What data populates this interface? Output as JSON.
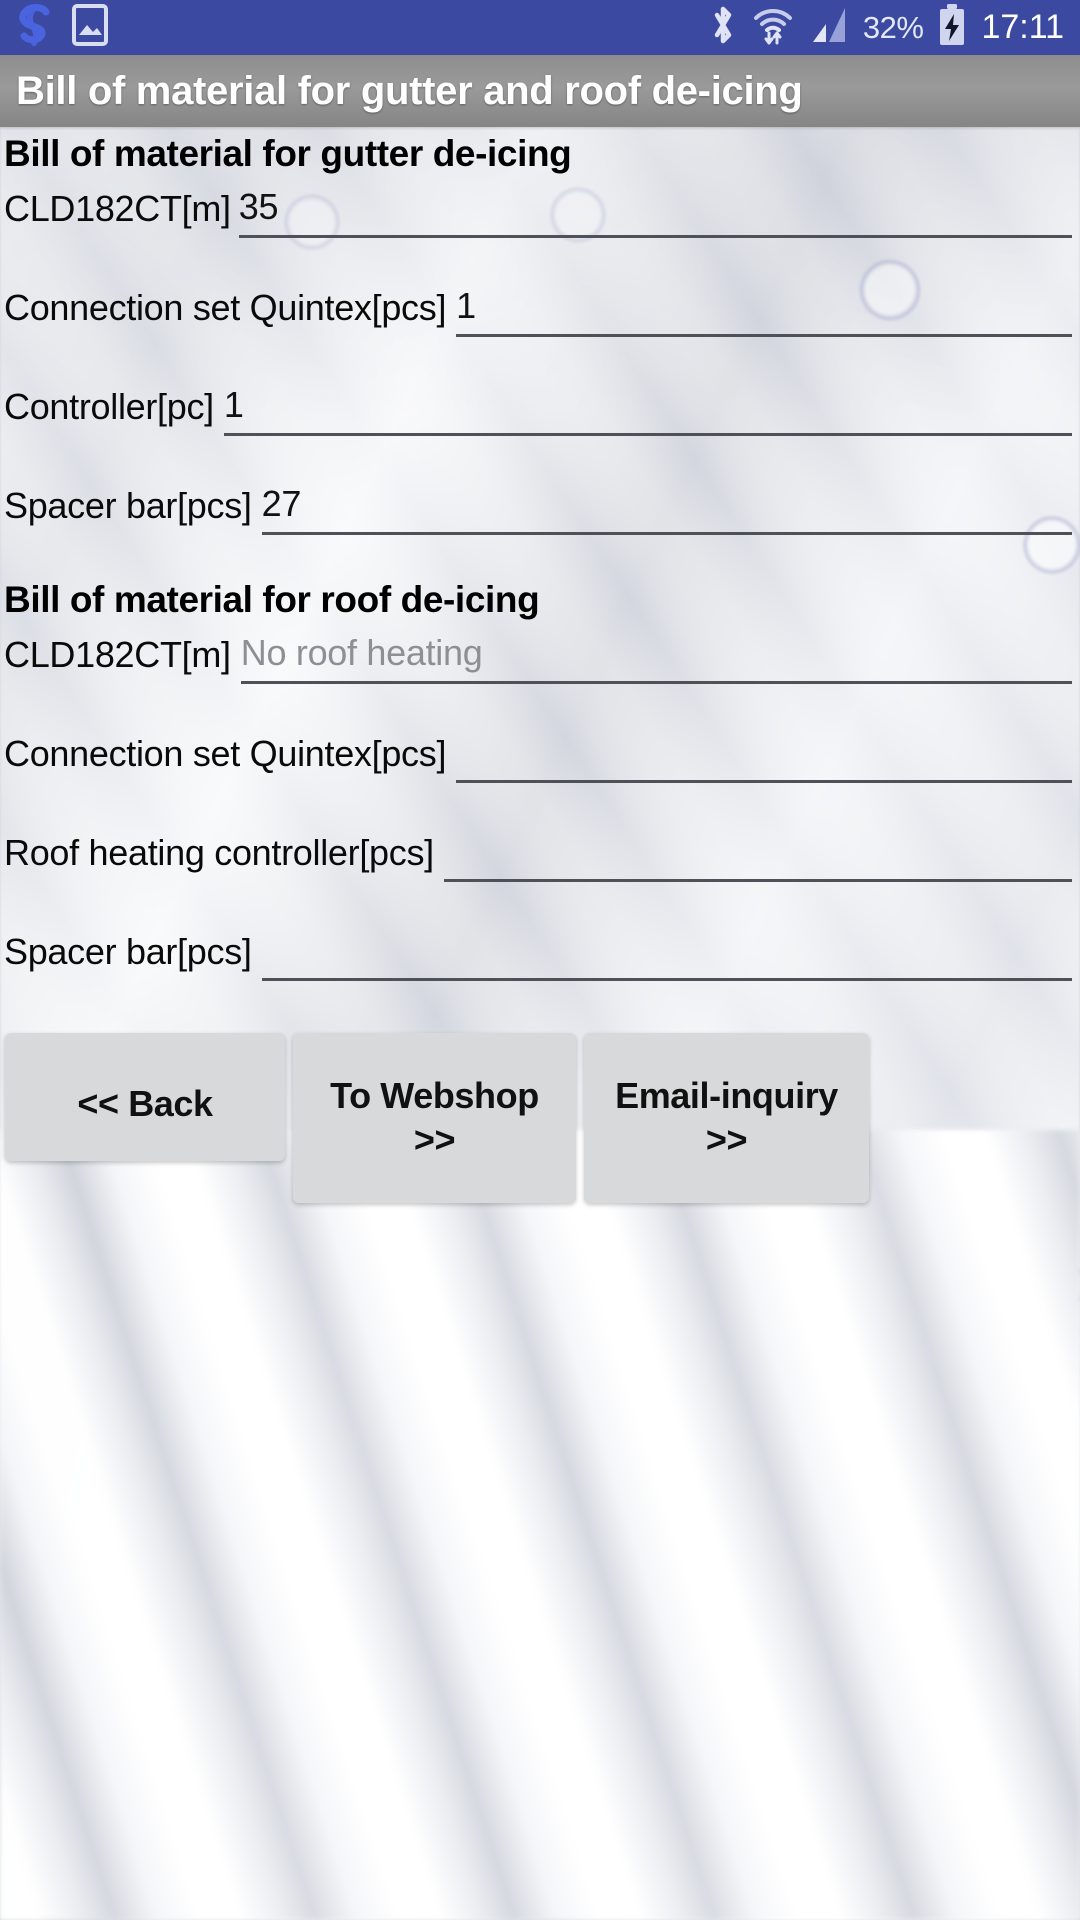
{
  "status_bar": {
    "background_color": "#3b4aa0",
    "left_icons": [
      {
        "name": "app-s-logo-icon",
        "label": "S"
      },
      {
        "name": "screenshot-image-icon",
        "label": "image"
      }
    ],
    "right_icons": [
      {
        "name": "bluetooth-icon",
        "label": "bluetooth"
      },
      {
        "name": "wifi-icon",
        "label": "wifi"
      },
      {
        "name": "cellular-signal-icon",
        "label": "signal"
      }
    ],
    "battery_percent": "32%",
    "battery_state": "charging",
    "clock": "17:11"
  },
  "action_bar": {
    "title": "Bill of material for gutter and roof de-icing",
    "background_color": "#919191",
    "text_color": "#ffffff"
  },
  "gutter_section": {
    "heading": "Bill of material for gutter de-icing",
    "rows": [
      {
        "label": "CLD182CT[m]",
        "value": "35",
        "placeholder": "",
        "is_placeholder": false
      },
      {
        "label": "Connection set Quintex[pcs]",
        "value": "1",
        "placeholder": "",
        "is_placeholder": false
      },
      {
        "label": "Controller[pc]",
        "value": "1",
        "placeholder": "",
        "is_placeholder": false
      },
      {
        "label": "Spacer bar[pcs]",
        "value": "27",
        "placeholder": "",
        "is_placeholder": false
      }
    ]
  },
  "roof_section": {
    "heading": "Bill of material for roof de-icing",
    "rows": [
      {
        "label": "CLD182CT[m]",
        "value": "No roof heating",
        "placeholder": "No roof heating",
        "is_placeholder": true
      },
      {
        "label": "Connection set Quintex[pcs]",
        "value": "",
        "placeholder": "",
        "is_placeholder": false
      },
      {
        "label": " Roof heating controller[pcs]",
        "value": "",
        "placeholder": "",
        "is_placeholder": false
      },
      {
        "label": "Spacer bar[pcs]",
        "value": "",
        "placeholder": "",
        "is_placeholder": false
      }
    ]
  },
  "buttons": {
    "back": "<< Back",
    "webshop_line1": "To Webshop",
    "webshop_line2": ">>",
    "email_line1": "Email-inquiry",
    "email_line2": ">>",
    "face_color": "#d7d9da"
  }
}
